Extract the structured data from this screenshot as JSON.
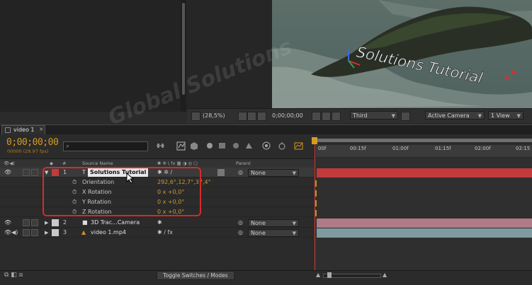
{
  "viewer": {
    "overlay_text": "Solutions Tutorial",
    "zoom": "(28,5%)",
    "timecode": "0;00;00;00",
    "view_mode": "Third",
    "camera": "Active Camera",
    "views": "1 View"
  },
  "timeline": {
    "tab_label": "video 1",
    "current_time": "0;00;00;00",
    "frame_info": "00000 (29.97 fps)",
    "search_placeholder": "",
    "ruler_ticks": [
      "00f",
      "00:15f",
      "01:00f",
      "01:15f",
      "02:00f",
      "02:15"
    ],
    "columns": {
      "hash": "#",
      "source_name": "Source Name",
      "parent": "Parent"
    },
    "layers": [
      {
        "num": "1",
        "name": "Solutions Tutorial",
        "parent": "None",
        "color": "#c23a3a"
      },
      {
        "num": "2",
        "name": "3D Trac...Camera",
        "parent": "None",
        "color": "#b07a86"
      },
      {
        "num": "3",
        "name": "video 1.mp4",
        "parent": "None",
        "color": "#7f9aa0"
      }
    ],
    "properties": [
      {
        "name": "Orientation",
        "value": "292,6°,12,7°,37,4°"
      },
      {
        "name": "X Rotation",
        "value": "0 x +0,0°"
      },
      {
        "name": "Y Rotation",
        "value": "0 x +0,0°"
      },
      {
        "name": "Z Rotation",
        "value": "0 x +0,0°"
      }
    ],
    "toggle_label": "Toggle Switches / Modes"
  },
  "watermark": "Global Solutions",
  "colors": {
    "accent_orange": "#d49a22",
    "highlight_red": "#d72a2a",
    "layer1_bar": "#c23a3a",
    "layer2_bar": "#b07a86",
    "layer3_bar": "#7f9aa0"
  }
}
